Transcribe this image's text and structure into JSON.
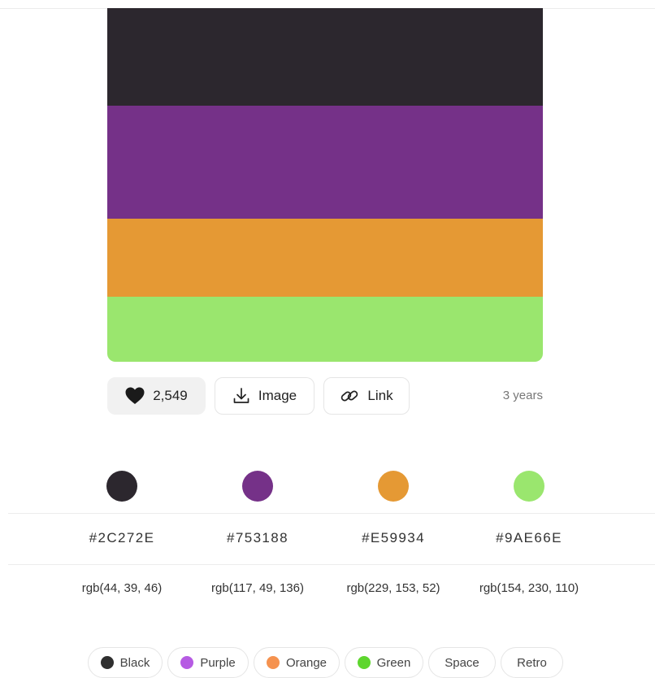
{
  "palette": {
    "colors": [
      {
        "hex": "#2C272E",
        "rgb": "rgb(44, 39, 46)"
      },
      {
        "hex": "#753188",
        "rgb": "rgb(117, 49, 136)"
      },
      {
        "hex": "#E59934",
        "rgb": "rgb(229, 153, 52)"
      },
      {
        "hex": "#9AE66E",
        "rgb": "rgb(154, 230, 110)"
      }
    ]
  },
  "actions": {
    "likes": "2,549",
    "like_icon": "heart-icon",
    "image_label": "Image",
    "image_icon": "download-icon",
    "link_label": "Link",
    "link_icon": "link-icon",
    "age": "3 years"
  },
  "tags": [
    {
      "label": "Black",
      "color": "#2F2F2F"
    },
    {
      "label": "Purple",
      "color": "#B65BE3"
    },
    {
      "label": "Orange",
      "color": "#F5924F"
    },
    {
      "label": "Green",
      "color": "#5ED62E"
    },
    {
      "label": "Space"
    },
    {
      "label": "Retro"
    }
  ]
}
